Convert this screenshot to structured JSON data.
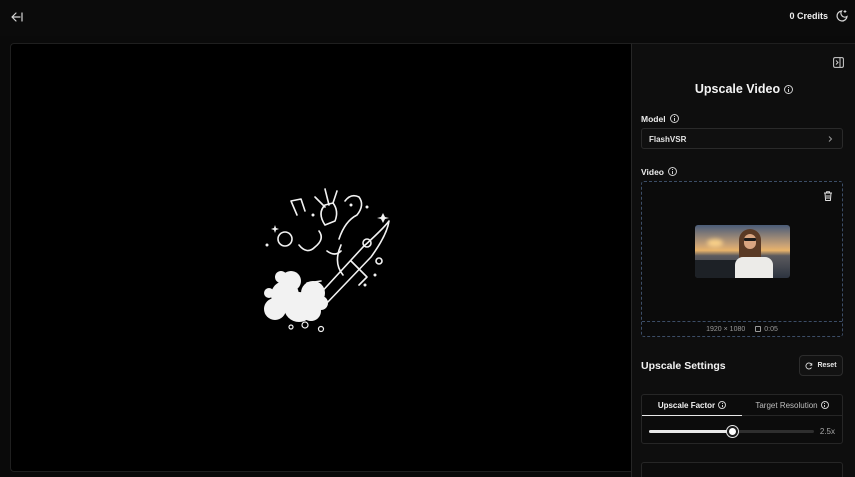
{
  "header": {
    "credits": "0 Credits"
  },
  "panel": {
    "title": "Upscale Video",
    "model": {
      "label": "Model",
      "value": "FlashVSR"
    },
    "video": {
      "label": "Video",
      "resolution": "1920 × 1080",
      "duration": "0:05"
    },
    "settings": {
      "title": "Upscale Settings",
      "reset_label": "Reset",
      "tabs": [
        {
          "label": "Upscale Factor",
          "active": true
        },
        {
          "label": "Target Resolution",
          "active": false
        }
      ],
      "factor": {
        "value": "2.5x",
        "fraction": 0.5
      }
    }
  },
  "colors": {
    "background": "#0a0a0a",
    "panel": "#0e0e0e",
    "dashed_border": "#3c4d66",
    "accent": "#e9e9e9"
  },
  "icons": [
    "back-arrow-icon",
    "theme-toggle-icon",
    "collapse-panel-icon",
    "info-icon",
    "chevron-right-icon",
    "trash-icon",
    "film-icon",
    "refresh-icon"
  ]
}
